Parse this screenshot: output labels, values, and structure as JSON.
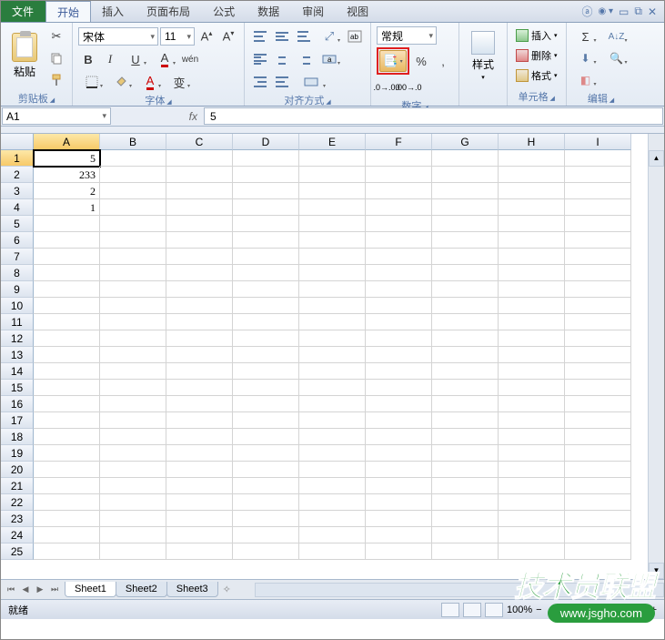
{
  "menu": {
    "file": "文件",
    "tabs": [
      "开始",
      "插入",
      "页面布局",
      "公式",
      "数据",
      "审阅",
      "视图"
    ],
    "active_index": 0
  },
  "ribbon": {
    "clipboard": {
      "label": "剪贴板",
      "paste": "粘贴"
    },
    "font": {
      "label": "字体",
      "name": "宋体",
      "size": "11"
    },
    "alignment": {
      "label": "对齐方式"
    },
    "number": {
      "label": "数字",
      "format": "常规",
      "percent": "%",
      "comma": ","
    },
    "styles": {
      "label": "样式",
      "btn": "样式"
    },
    "cells": {
      "label": "单元格",
      "insert": "插入",
      "delete": "删除",
      "format": "格式"
    },
    "editing": {
      "label": "编辑"
    }
  },
  "namebox": "A1",
  "formula": "5",
  "columns": [
    "A",
    "B",
    "C",
    "D",
    "E",
    "F",
    "G",
    "H",
    "I"
  ],
  "active_col": 0,
  "rows": 25,
  "active_row": 0,
  "data": {
    "0": {
      "0": "5"
    },
    "1": {
      "0": "233"
    },
    "2": {
      "0": "2"
    },
    "3": {
      "0": "1"
    }
  },
  "sheets": [
    "Sheet1",
    "Sheet2",
    "Sheet3"
  ],
  "active_sheet": 0,
  "status": "就绪",
  "zoom": "100%",
  "watermark": {
    "text": "技术员联盟",
    "url": "www.jsgho.com"
  }
}
